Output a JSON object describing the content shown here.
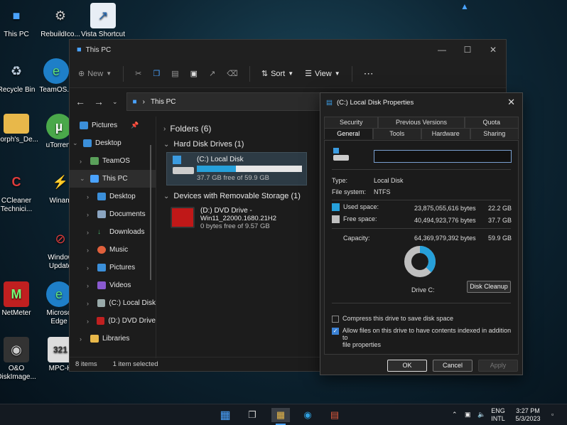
{
  "desktop": {
    "icons": [
      {
        "label": "This PC"
      },
      {
        "label": "RebuildIco..."
      },
      {
        "label": "Vista Shortcut"
      },
      {
        "label": "Recycle Bin"
      },
      {
        "label": "TeamOS..."
      },
      {
        "label": "Morph's_De..."
      },
      {
        "label": "uTorrent"
      },
      {
        "label": "CCleaner"
      },
      {
        "label": "Technici..."
      },
      {
        "label": "Winam"
      },
      {
        "label": "Window"
      },
      {
        "label": "Update"
      },
      {
        "label": "NetMeter"
      },
      {
        "label": "Microso"
      },
      {
        "label": "Edge"
      },
      {
        "label": "O&O"
      },
      {
        "label": "DiskImage..."
      },
      {
        "label": "MPC-H"
      }
    ]
  },
  "explorer": {
    "title": "This PC",
    "toolbar": {
      "new": "New",
      "sort": "Sort",
      "view": "View"
    },
    "address": "This PC",
    "nav": [
      {
        "label": "Pictures"
      },
      {
        "label": "Desktop"
      },
      {
        "label": "TeamOS"
      },
      {
        "label": "This PC"
      },
      {
        "label": "Desktop"
      },
      {
        "label": "Documents"
      },
      {
        "label": "Downloads"
      },
      {
        "label": "Music"
      },
      {
        "label": "Pictures"
      },
      {
        "label": "Videos"
      },
      {
        "label": "(C:) Local Disk"
      },
      {
        "label": "(D:) DVD Drive"
      },
      {
        "label": "Libraries"
      }
    ],
    "groups": {
      "folders": "Folders (6)",
      "hdd": "Hard Disk Drives (1)",
      "removable": "Devices with Removable Storage (1)"
    },
    "drive_c": {
      "name": "(C:) Local Disk",
      "free": "37.7 GB free of 59.9 GB",
      "used_fraction": 0.37
    },
    "drive_d": {
      "name": "(D:) DVD Drive -",
      "label": "Win11_22000.1680.21H2",
      "free": "0 bytes free of 9.57 GB"
    },
    "status": {
      "items": "8 items",
      "selected": "1 item selected"
    }
  },
  "dialog": {
    "title": "(C:) Local Disk Properties",
    "tabs_top": [
      "Security",
      "Previous Versions",
      "Quota"
    ],
    "tabs_bottom": [
      "General",
      "Tools",
      "Hardware",
      "Sharing"
    ],
    "type_label": "Type:",
    "type_value": "Local Disk",
    "fs_label": "File system:",
    "fs_value": "NTFS",
    "used_label": "Used space:",
    "used_bytes": "23,875,055,616 bytes",
    "used_gb": "22.2 GB",
    "free_label": "Free space:",
    "free_bytes": "40,494,923,776 bytes",
    "free_gb": "37.7 GB",
    "cap_label": "Capacity:",
    "cap_bytes": "64,369,979,392 bytes",
    "cap_gb": "59.9 GB",
    "drive_label": "Drive C:",
    "cleanup": "Disk Cleanup",
    "compress": "Compress this drive to save disk space",
    "index_1": "Allow files on this drive to have contents indexed in addition to",
    "index_2": "file properties",
    "ok": "OK",
    "cancel": "Cancel",
    "apply": "Apply",
    "used_fraction": 0.371,
    "colors": {
      "used": "#26a0da",
      "free": "#bfbfbf"
    }
  },
  "taskbar": {
    "lang_1": "ENG",
    "lang_2": "INTL",
    "time": "3:27 PM",
    "date": "5/3/2023"
  }
}
